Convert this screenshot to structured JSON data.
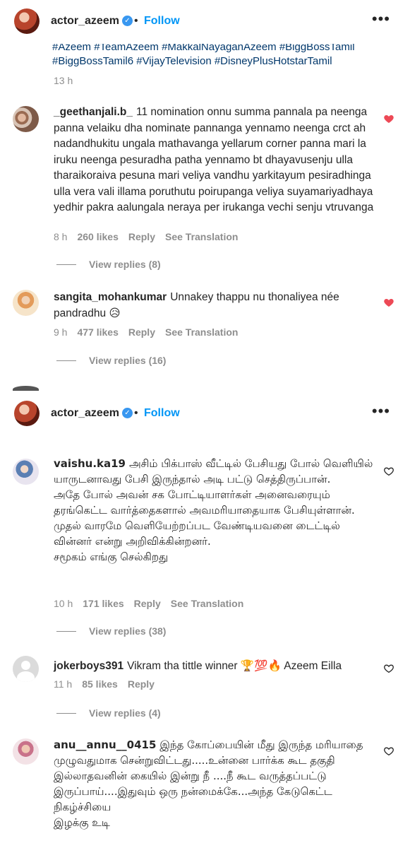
{
  "panel1": {
    "header": {
      "username": "actor_azeem",
      "verified_mark": "✓",
      "separator": "•",
      "follow_label": "Follow",
      "more_label": "•••"
    },
    "hashtags_line1": "#Azeem #TeamAzeem #MakkalNayaganAzeem #BiggBossTamil",
    "hashtags_line2": "#BiggBossTamil6 #VijayTelevision #DisneyPlusHotstarTamil",
    "post_time": "13 h",
    "comments": [
      {
        "username": "_geethanjali.b_",
        "text": "11 nomination onnu summa pannala pa neenga panna velaiku dha nominate pannanga yennamo neenga crct ah nadandhukitu ungala mathavanga yellarum corner panna mari la iruku neenga pesuradha patha yennamo bt dhayavusenju ulla tharaikoraiva pesuna mari veliya vandhu yarkitayum pesiradhinga ulla vera vali illama poruthutu poirupanga veliya suyamariyadhaya yedhir pakra aalungala neraya per irukanga vechi senju vtruvanga",
        "time": "8 h",
        "likes": "260 likes",
        "reply": "Reply",
        "translate": "See Translation",
        "view_replies": "View replies (8)",
        "liked": true
      },
      {
        "username": "sangita_mohankumar",
        "text": "Unnakey thappu nu thonaliyea née pandradhu 😥",
        "time": "9 h",
        "likes": "477 likes",
        "reply": "Reply",
        "translate": "See Translation",
        "view_replies": "View replies (16)",
        "liked": true
      }
    ]
  },
  "panel2": {
    "header": {
      "username": "actor_azeem",
      "verified_mark": "✓",
      "separator": "•",
      "follow_label": "Follow",
      "more_label": "•••"
    },
    "comments": [
      {
        "username": "vaishu.ka19",
        "text": "அசிம் பிக்பாஸ் வீட்டில் பேசியது போல் வெளியில் யாருடனாவது பேசி இருந்தால் அடி பட்டு செத்திருப்பான்.",
        "text2": "அதே போல் அவன் சக போட்டியாளர்கள் அனைவரையும் தரங்கெட்ட வார்த்தைகளால் அவமரியாதையாக பேசியுள்ளான்.",
        "text3": "முதல் வாரமே வெளியேற்றப்பட வேண்டியவனை டைட்டில் வின்னர் என்று அறிவிக்கின்றனர்.",
        "text4": "சமூகம் எங்கு செல்கிறது",
        "time": "10 h",
        "likes": "171 likes",
        "reply": "Reply",
        "translate": "See Translation",
        "view_replies": "View replies (38)"
      },
      {
        "username": "jokerboys391",
        "text": "Vikram tha tittle winner 🏆💯🔥 Azeem Eilla",
        "time": "11 h",
        "likes": "85 likes",
        "reply": "Reply",
        "view_replies": "View replies (4)"
      },
      {
        "username": "anu__annu__0415",
        "text": "இந்த கோப்பையின் மீது இருந்த மரியாதை முழுவதுமாக சென்றுவிட்டது.....உன்னை பார்க்க கூட தகுதி இல்லாதவனின் கையில் இன்று நீ ....நீ கூட வருத்தப்பட்டு இருப்பாய்....இதுவும் ஒரு நன்மைக்கே...அந்த கேடுகெட்ட நிகழ்ச்சியை",
        "text_cut": "இழக்கு உடி"
      }
    ]
  },
  "colors": {
    "link": "#0095f6",
    "hashtag": "#00376b",
    "heart": "#ed4956",
    "meta": "#8e8e8e"
  }
}
